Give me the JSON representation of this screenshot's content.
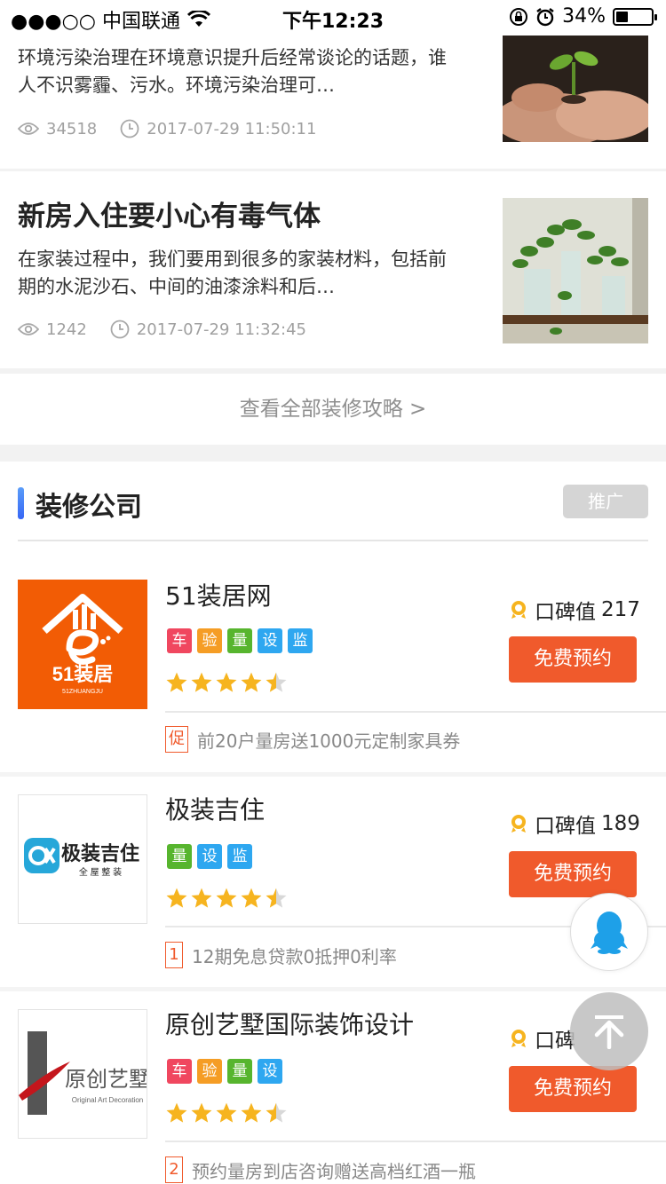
{
  "status_bar": {
    "carrier": "●●●○○ 中国联通",
    "time": "下午12:23",
    "battery": "34%",
    "battery_level": 0.34
  },
  "articles": [
    {
      "title": "",
      "description": "环境污染治理在环境意识提升后经常谈论的话题，谁人不识雾霾、污水。环境污染治理可…",
      "views": "34518",
      "datetime": "2017-07-29 11:50:11",
      "thumbnail": "plant-sprout-icon"
    },
    {
      "title": "新房入住要小心有毒气体",
      "description": "在家装过程中，我们要用到很多的家装材料，包括前期的水泥沙石、中间的油漆涂料和后…",
      "views": "1242",
      "datetime": "2017-07-29 11:32:45",
      "thumbnail": "potted-plants-icon"
    }
  ],
  "view_all_link": "查看全部装修攻略 >",
  "company_section": {
    "title": "装修公司",
    "promo_label": "推广"
  },
  "companies": [
    {
      "name": "51装居网",
      "logo_text": "51装居",
      "logo_subtext": "51ZHUANGJU",
      "tags": [
        {
          "label": "车",
          "color": "#f0475f"
        },
        {
          "label": "验",
          "color": "#f59d25"
        },
        {
          "label": "量",
          "color": "#57b52e"
        },
        {
          "label": "设",
          "color": "#2ea7f0"
        },
        {
          "label": "监",
          "color": "#2ea7f0"
        }
      ],
      "rating": 4.5,
      "reputation_label": "口碑值",
      "reputation_value": "217",
      "book_label": "免费预约",
      "promo_badge": "促",
      "promo_text": "前20户量房送1000元定制家具券"
    },
    {
      "name": "极装吉住",
      "logo_text": "极装吉住",
      "logo_subtext": "全 屋 整 装",
      "tags": [
        {
          "label": "量",
          "color": "#57b52e"
        },
        {
          "label": "设",
          "color": "#2ea7f0"
        },
        {
          "label": "监",
          "color": "#2ea7f0"
        }
      ],
      "rating": 4.5,
      "reputation_label": "口碑值",
      "reputation_value": "189",
      "book_label": "免费预约",
      "promo_badge": "1",
      "promo_text": "12期免息贷款0抵押0利率"
    },
    {
      "name": "原创艺墅国际装饰设计",
      "logo_text": "原创艺墅",
      "logo_subtext": "Original Art Decoration",
      "tags": [
        {
          "label": "车",
          "color": "#f0475f"
        },
        {
          "label": "验",
          "color": "#f59d25"
        },
        {
          "label": "量",
          "color": "#57b52e"
        },
        {
          "label": "设",
          "color": "#2ea7f0"
        }
      ],
      "rating": 4.5,
      "reputation_label": "口碑",
      "reputation_value": "",
      "book_label": "免费预约",
      "promo_badge": "2",
      "promo_text": "预约量房到店咨询赠送高档红酒一瓶"
    }
  ],
  "floating": {
    "qq_icon": "qq-penguin-icon",
    "top_icon": "back-to-top-icon"
  },
  "colors": {
    "accent_orange": "#f05a2c",
    "section_bar_blue": "#4a86f7",
    "star_yellow": "#f6b41f"
  }
}
